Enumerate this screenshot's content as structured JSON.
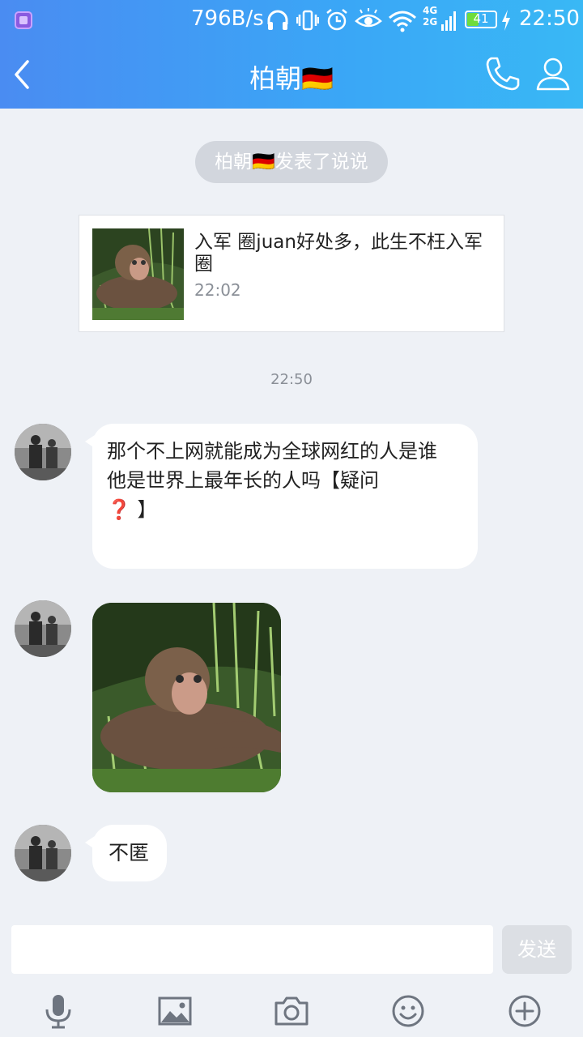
{
  "status_bar": {
    "net_speed": "796B/s",
    "net_4g": "4G",
    "net_2g": "2G",
    "battery": "41",
    "battery_level": 0.41,
    "time": "22:50"
  },
  "header": {
    "title": "柏朝🇩🇪"
  },
  "notice": {
    "text": "柏朝🇩🇪发表了说说"
  },
  "post_card": {
    "text": "入军 圈juan好处多，此生不枉入军圈",
    "time": "22:02"
  },
  "time_divider": "22:50",
  "messages": {
    "msg1_line1": "那个不上网就能成为全球网红的人是谁",
    "msg1_line2": "他是世界上最年长的人吗【疑问",
    "msg1_q": "❓",
    "msg1_end": "】",
    "msg3": "不匿"
  },
  "input": {
    "placeholder": "",
    "send_label": "发送"
  },
  "colors": {
    "header_start": "#4a8cf2",
    "header_end": "#39b8f5",
    "background": "#eef1f6"
  },
  "icons": [
    "back-icon",
    "phone-icon",
    "profile-icon",
    "mic-icon",
    "image-icon",
    "camera-icon",
    "emoji-icon",
    "plus-icon"
  ]
}
